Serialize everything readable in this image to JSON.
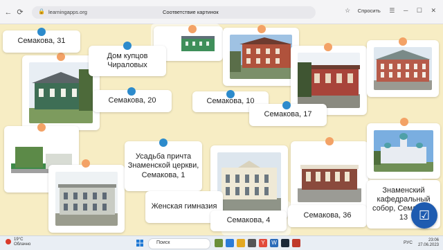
{
  "browser": {
    "url": "learningapps.org",
    "page_title": "Соответствие картинок",
    "ask_label": "Спросить"
  },
  "cards": {
    "semakova31": "Семакова, 31",
    "chiralov": "Дом купцов Чираловых",
    "semakova20": "Семакова, 20",
    "semakova10": "Семакова, 10",
    "semakova17": "Семакова, 17",
    "usadba": "Усадьба причта Знаменской церкви, Семакова, 1",
    "gymnasium": "Женская гимназия",
    "semakova4": "Семакова, 4",
    "semakova36": "Семакова, 36",
    "cathedral": "Знаменский кафедральный собор, Семакова, 13"
  },
  "taskbar": {
    "temp": "19°C",
    "weather": "Облачно",
    "search_placeholder": "Поиск",
    "lang": "РУС",
    "time": "23:06",
    "date": "27.06.2023"
  },
  "colors": {
    "board_bg": "#f7edc4",
    "pin_blue": "#2d8bcc",
    "pin_orange": "#f3a266",
    "check_button": "#1e5bb0"
  }
}
